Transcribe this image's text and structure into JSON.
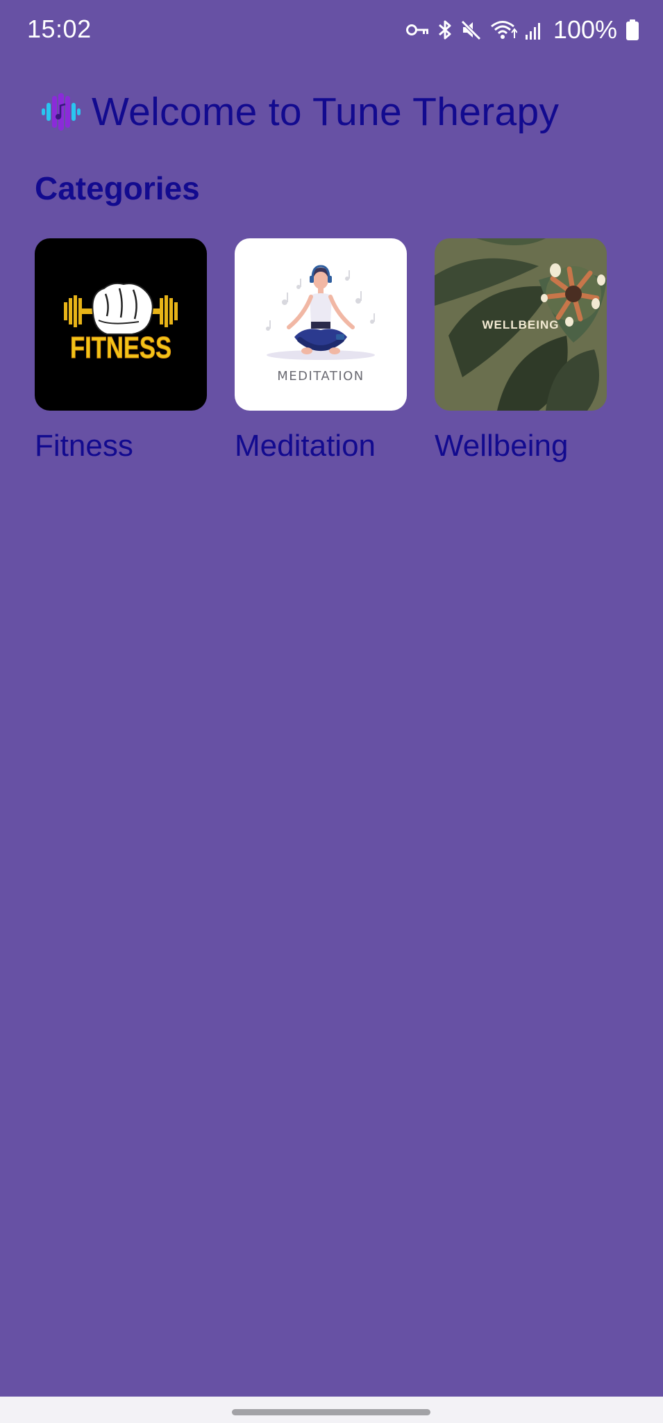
{
  "status_bar": {
    "time": "15:02",
    "battery_percent": "100%",
    "icons": [
      "vpn-key-icon",
      "bluetooth-icon",
      "mute-icon",
      "wifi-icon",
      "signal-icon",
      "battery-icon"
    ]
  },
  "header": {
    "logo_icon": "music-logo-icon",
    "title": "Welcome to Tune Therapy"
  },
  "categories": {
    "heading": "Categories",
    "items": [
      {
        "label": "Fitness",
        "image_text": "FITNESS",
        "image": "fitness-image"
      },
      {
        "label": "Meditation",
        "image_text": "MEDITATION",
        "image": "meditation-image"
      },
      {
        "label": "Wellbeing",
        "image_text": "WELLBEING",
        "image": "wellbeing-image"
      }
    ]
  },
  "colors": {
    "background": "#6751A4",
    "text_primary": "#120A8F",
    "status_text": "#FFFFFF",
    "nav_bar": "#F3F2F6"
  }
}
